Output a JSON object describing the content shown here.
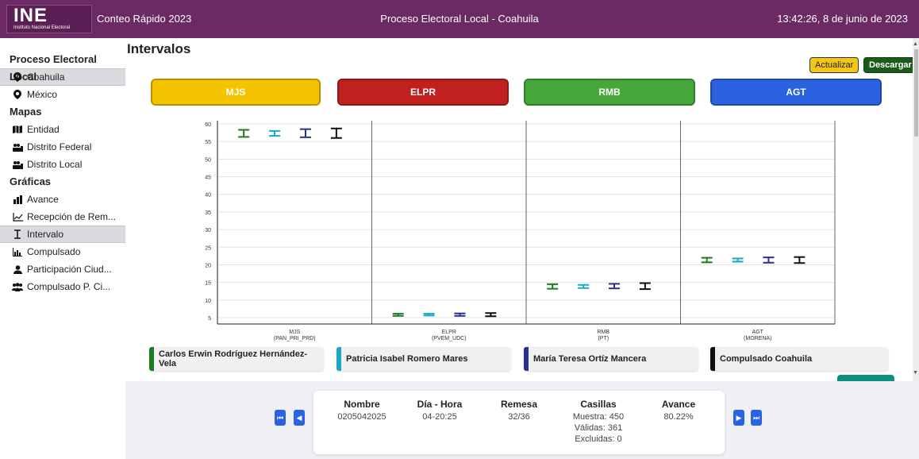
{
  "header": {
    "logo_text": "INE",
    "logo_sub": "Instituto Nacional Electoral",
    "app_name": "Conteo Rápido 2023",
    "process_title": "Proceso Electoral Local - Coahuila",
    "datetime": "13:42:26, 8 de junio de 2023"
  },
  "sidebar": {
    "section1": "Proceso Electoral Local",
    "items1": [
      "Coahuila",
      "México"
    ],
    "section2": "Mapas",
    "items2": [
      "Entidad",
      "Distrito Federal",
      "Distrito Local"
    ],
    "section3": "Gráficas",
    "items3": [
      "Avance",
      "Recepción de Rem...",
      "Intervalo",
      "Compulsado",
      "Participación Ciud...",
      "Compulsado P. Ci..."
    ]
  },
  "main": {
    "title": "Intervalos",
    "update_label": "Actualizar",
    "download_label": "Descargar",
    "parties": [
      "MJS",
      "ELPR",
      "RMB",
      "AGT"
    ]
  },
  "chart_data": {
    "type": "errorbar",
    "ylim": [
      5,
      60
    ],
    "yticks": [
      5,
      10,
      15,
      20,
      25,
      30,
      35,
      40,
      45,
      50,
      55,
      60
    ],
    "grid": true,
    "categories": [
      {
        "name": "MJS",
        "sub": "(PAN_PRI_PRD)"
      },
      {
        "name": "ELPR",
        "sub": "(PVEM_UDC)"
      },
      {
        "name": "RMB",
        "sub": "(PT)"
      },
      {
        "name": "AGT",
        "sub": "(MORENA)"
      }
    ],
    "series": [
      {
        "name": "Carlos Erwin Rodríguez Hernández-Vela",
        "color": "#1e7a1e",
        "ranges": [
          [
            56.3,
            58.3
          ],
          [
            5.5,
            6.1
          ],
          [
            13.2,
            14.5
          ],
          [
            20.7,
            22.0
          ]
        ]
      },
      {
        "name": "Patricia Isabel Romero Mares",
        "color": "#1aa7c7",
        "ranges": [
          [
            56.6,
            58.0
          ],
          [
            5.6,
            6.1
          ],
          [
            13.4,
            14.3
          ],
          [
            20.9,
            21.8
          ]
        ]
      },
      {
        "name": "María Teresa Ortíz Mancera",
        "color": "#2a2f8a",
        "ranges": [
          [
            56.2,
            58.5
          ],
          [
            5.5,
            6.2
          ],
          [
            13.3,
            14.6
          ],
          [
            20.6,
            22.1
          ]
        ]
      },
      {
        "name": "Compulsado Coahuila",
        "color": "#111111",
        "ranges": [
          [
            56.0,
            58.7
          ],
          [
            5.4,
            6.3
          ],
          [
            13.1,
            14.8
          ],
          [
            20.5,
            22.2
          ]
        ]
      }
    ]
  },
  "footer": {
    "headers": [
      "Nombre",
      "Día - Hora",
      "Remesa",
      "Casillas",
      "Avance"
    ],
    "nombre": "0205042025",
    "dia_hora": "04-20:25",
    "remesa": "32/36",
    "muestra": "Muestra: 450",
    "validas": "Válidas: 361",
    "excluidas": "Excluidas: 0",
    "avance": "80.22%"
  },
  "colors": {
    "header": "#6b2a63",
    "accent": "#2b62e0"
  }
}
